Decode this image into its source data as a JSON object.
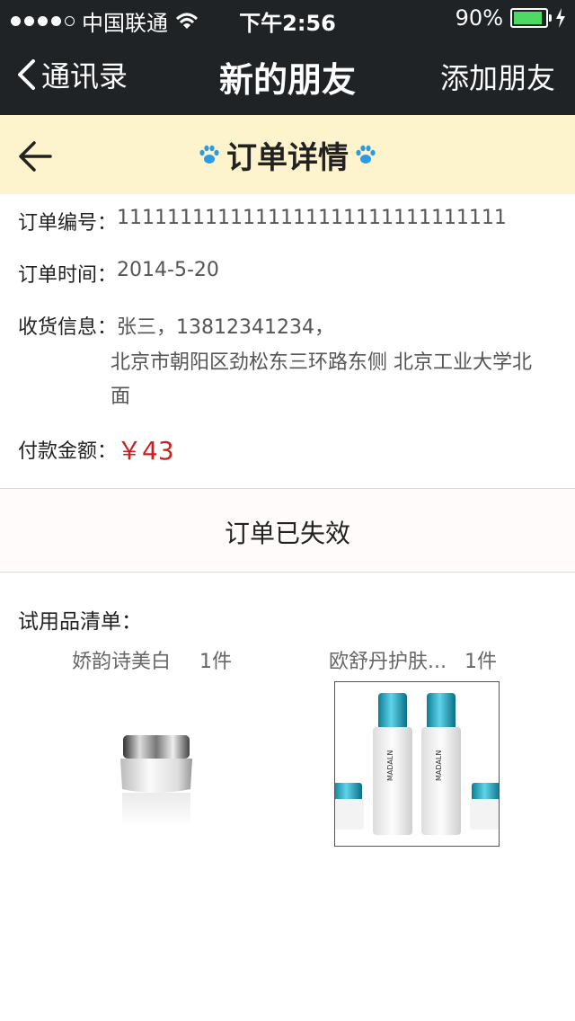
{
  "status_bar": {
    "carrier": "中国联通",
    "time": "下午2:56",
    "battery": "90%",
    "battery_level": 0.9
  },
  "nav": {
    "back_label": "通讯录",
    "title": "新的朋友",
    "action_label": "添加朋友"
  },
  "page": {
    "title": "订单详情"
  },
  "order": {
    "number_label": "订单编号：",
    "number_value": "1111111111111111111111111111111",
    "time_label": "订单时间：",
    "time_value": "2014-5-20",
    "shipping_label": "收货信息：",
    "shipping_line1": "张三，13812341234，",
    "shipping_line2": "北京市朝阳区劲松东三环路东侧  北京工业大学北面",
    "amount_label": "付款金额：",
    "amount_value": "￥43"
  },
  "order_status": "订单已失效",
  "trial_list": {
    "title": "试用品清单：",
    "items": [
      {
        "name": "娇韵诗美白",
        "qty": "1件"
      },
      {
        "name": "欧舒丹护肤...",
        "qty": "1件",
        "brand_text": "MADALN"
      }
    ]
  },
  "colors": {
    "nav_bg": "#1f2326",
    "subheader_bg": "#fdf3cd",
    "amount": "#cc1f1f",
    "paw": "#2b9be3",
    "battery": "#4cd964"
  }
}
